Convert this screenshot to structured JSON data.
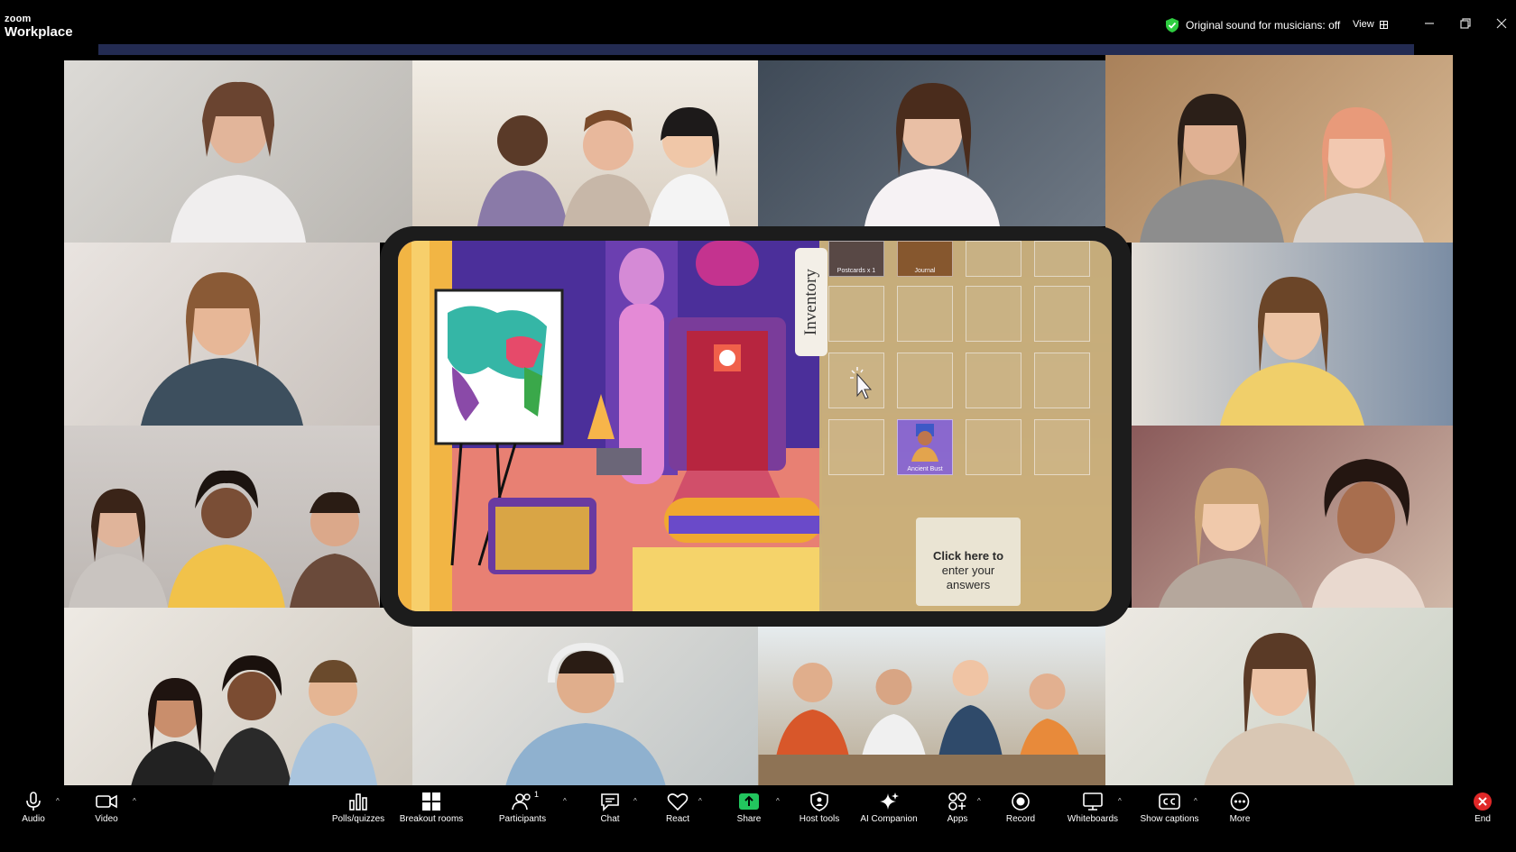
{
  "app": {
    "brand_small": "zoom",
    "brand_big": "Workplace"
  },
  "topbar": {
    "sound_status": "Original sound for musicians: off",
    "view_label": "View"
  },
  "game": {
    "inventory_label": "Inventory",
    "items": [
      {
        "label": "Postcards x 1"
      },
      {
        "label": "Journal"
      },
      {
        "label": "Ancient Bust"
      }
    ],
    "answer_prompt_line1": "Click here to",
    "answer_prompt_line2": "enter your",
    "answer_prompt_line3": "answers"
  },
  "toolbar": {
    "audio": "Audio",
    "video": "Video",
    "polls": "Polls/quizzes",
    "breakout": "Breakout rooms",
    "participants": "Participants",
    "participants_count": "1",
    "chat": "Chat",
    "react": "React",
    "share": "Share",
    "host_tools": "Host tools",
    "ai_companion": "AI Companion",
    "apps": "Apps",
    "record": "Record",
    "whiteboards": "Whiteboards",
    "captions": "Show captions",
    "more": "More",
    "end": "End"
  },
  "colors": {
    "share_green": "#22c55e",
    "end_red": "#e02828",
    "strip_blue": "#232b52",
    "shield_green": "#2ecc40"
  }
}
